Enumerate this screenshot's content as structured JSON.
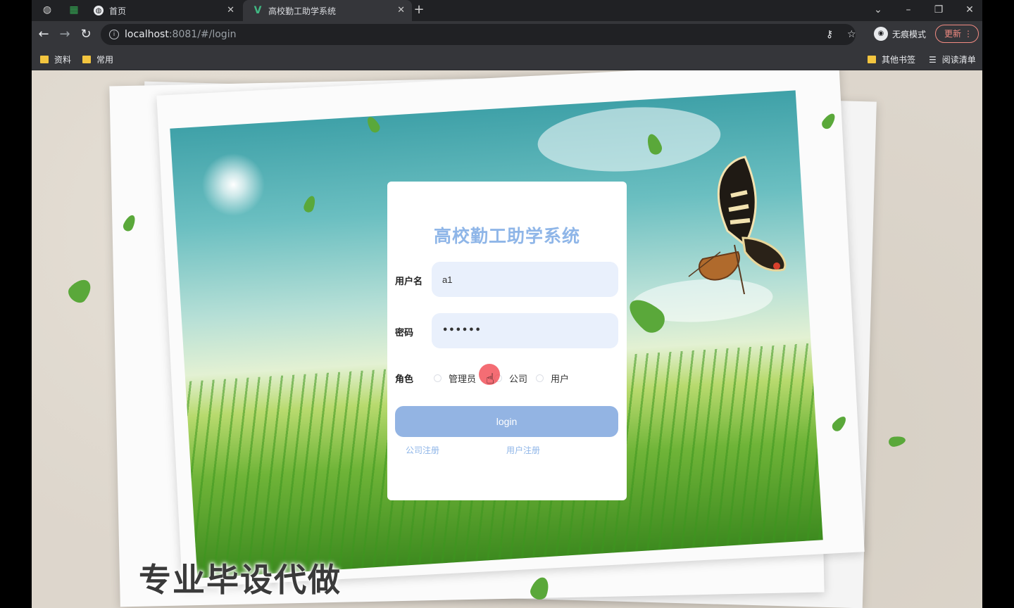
{
  "tabs": [
    {
      "label": "首页",
      "icon": "globe-icon"
    },
    {
      "label": "高校勤工助学系统",
      "icon": "vue-icon"
    }
  ],
  "toolbar": {
    "url_host": "localhost",
    "url_rest": ":8081/#/login",
    "profile_label": "无痕模式",
    "update_label": "更新"
  },
  "bookmarks": {
    "left": [
      "资料",
      "常用"
    ],
    "other": "其他书签",
    "reading": "阅读清单"
  },
  "login": {
    "title": "高校勤工助学系统",
    "username_label": "用户名",
    "username_value": "a1",
    "password_label": "密码",
    "password_value": "••••••",
    "role_label": "角色",
    "roles": [
      "管理员",
      "公司",
      "用户"
    ],
    "login_button": "login",
    "register_company": "公司注册",
    "register_user": "用户注册"
  },
  "watermark": "专业毕设代做",
  "colors": {
    "accent": "#8fb6e8",
    "button": "#93b4e3",
    "input_bg": "#e9f0fc"
  }
}
